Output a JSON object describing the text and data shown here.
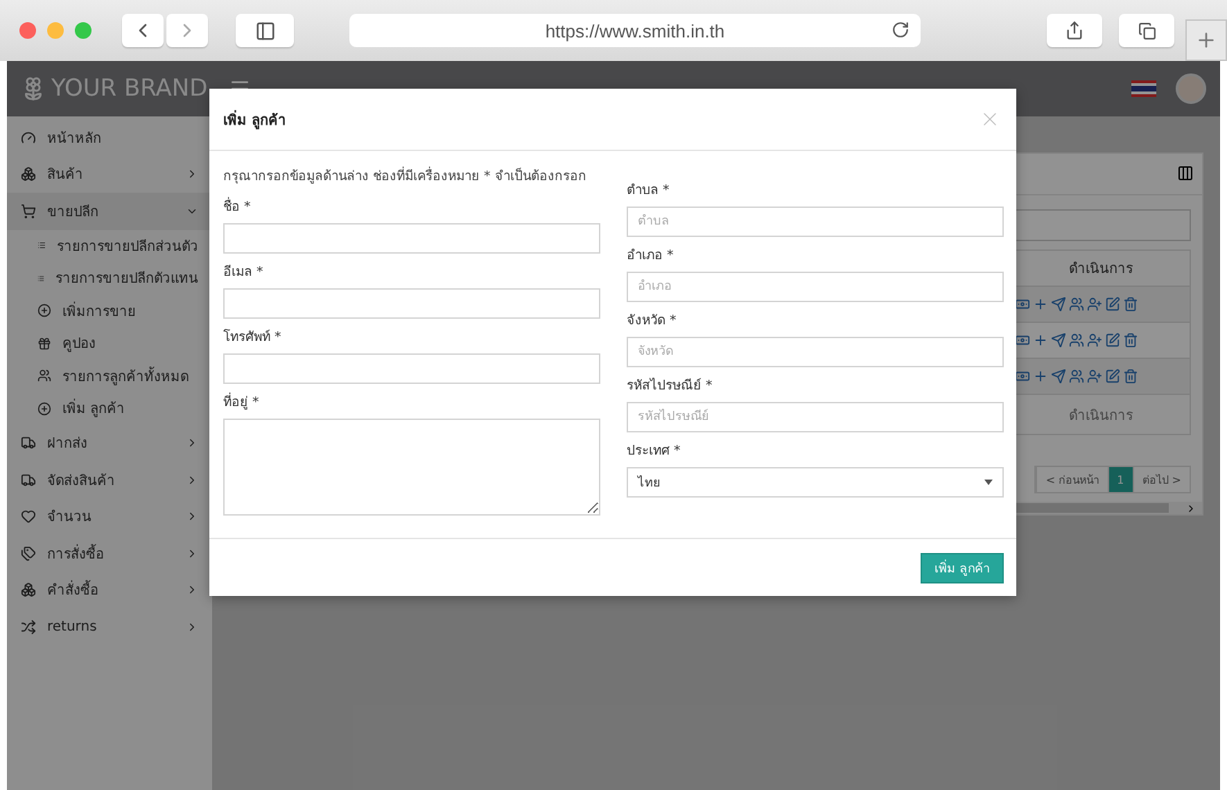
{
  "browser": {
    "url": "https://www.smith.in.th"
  },
  "header": {
    "brand": "YOUR BRAND"
  },
  "sidebar": {
    "items": [
      {
        "label": "หน้าหลัก"
      },
      {
        "label": "สินค้า",
        "expanded": false
      },
      {
        "label": "ขายปลีก",
        "expanded": true,
        "children": [
          {
            "label": "รายการขายปลีกส่วนตัว"
          },
          {
            "label": "รายการขายปลีกตัวแทน"
          },
          {
            "label": "เพิ่มการขาย"
          },
          {
            "label": "คูปอง"
          },
          {
            "label": "รายการลูกค้าทั้งหมด"
          },
          {
            "label": "เพิ่ม ลูกค้า"
          }
        ]
      },
      {
        "label": "ฝากส่ง",
        "expanded": false
      },
      {
        "label": "จัดส่งสินค้า",
        "expanded": false
      },
      {
        "label": "จำนวน",
        "expanded": false
      },
      {
        "label": "การสั่งซื้อ",
        "expanded": false
      },
      {
        "label": "คำสั่งซื้อ",
        "expanded": false
      },
      {
        "label": "returns",
        "expanded": false
      }
    ]
  },
  "table": {
    "header": "ดำเนินการ",
    "footer": "ดำเนินการ"
  },
  "pagination": [
    {
      "label": "< ก่อนหน้า",
      "selected": false
    },
    {
      "label": "1",
      "selected": true
    },
    {
      "label": "ต่อไป >",
      "selected": false
    }
  ],
  "modal": {
    "title": "เพิ่ม ลูกค้า",
    "note": "กรุณากรอกข้อมูลด้านล่าง ช่องที่มีเครื่องหมาย * จำเป็นต้องกรอก",
    "left_fields": [
      {
        "kind": "text",
        "label": "ชื่อ *"
      },
      {
        "kind": "text",
        "label": "อีเมล *"
      },
      {
        "kind": "text",
        "label": "โทรศัพท์ *"
      },
      {
        "kind": "textarea",
        "label": "ที่อยู่ *"
      }
    ],
    "right_fields": [
      {
        "kind": "text",
        "label": "ตำบล *",
        "placeholder": "ตำบล"
      },
      {
        "kind": "text",
        "label": "อำเภอ *",
        "placeholder": "อำเภอ"
      },
      {
        "kind": "text",
        "label": "จังหวัด *",
        "placeholder": "จังหวัด"
      },
      {
        "kind": "text",
        "label": "รหัสไปรษณีย์ *",
        "placeholder": "รหัสไปรษณีย์"
      },
      {
        "kind": "select",
        "label": "ประเทศ *",
        "value": "ไทย"
      }
    ],
    "submit": "เพิ่ม ลูกค้า"
  }
}
